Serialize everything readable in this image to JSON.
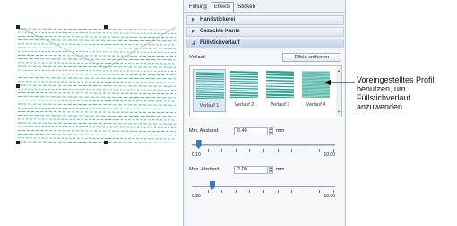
{
  "tabs": [
    {
      "label": "Füllung",
      "active": false
    },
    {
      "label": "Effekte",
      "active": true
    },
    {
      "label": "Sticken",
      "active": false
    }
  ],
  "sections": {
    "handstickerei": "Handstickerei",
    "gezackte_kante": "Gezackte Kante",
    "fuellstichverlauf": "Füllstichverlauf"
  },
  "verlauf": {
    "label": "Verlauf:",
    "remove_button": "Effekt entfernen",
    "profiles": [
      "Verlauf 1",
      "Verlauf 2",
      "Verlauf 3",
      "Verlauf 4"
    ],
    "selected_profile": "Verlauf 1"
  },
  "min_abstand": {
    "label": "Min. Abstand:",
    "value": "0.40",
    "unit": "mm",
    "range_min": "0.10",
    "range_max": "10.00",
    "slider_fraction": 0.03
  },
  "max_abstand": {
    "label": "Max. Abstand:",
    "value": "2.00",
    "unit": "mm",
    "range_min": "0.80",
    "range_max": "10.00",
    "slider_fraction": 0.13
  },
  "callout": {
    "text": "Voreingestelltes Profil benutzen, um Füllstichverlauf anzuwenden"
  },
  "colors": {
    "stitch": "#2aa593",
    "accent": "#3a78c6"
  }
}
